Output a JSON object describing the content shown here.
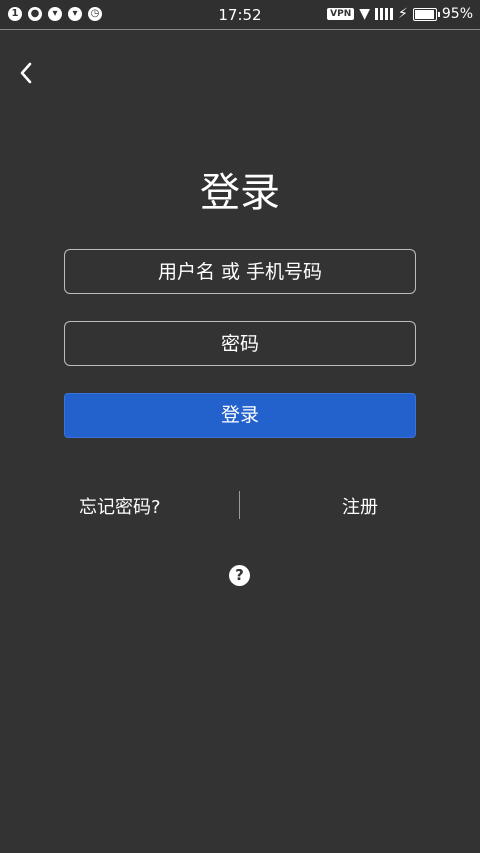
{
  "status_bar": {
    "time": "17:52",
    "vpn": "VPN",
    "battery": "95%",
    "battery_level": 0.95,
    "left_icons": [
      "notification-1-icon",
      "wechat-icon",
      "app-cat-icon",
      "app-cat-icon",
      "alarm-icon"
    ]
  },
  "header": {
    "back_icon": "back-arrow-icon"
  },
  "login": {
    "title": "登录",
    "username_placeholder": "用户名 或 手机号码",
    "password_placeholder": "密码",
    "submit_label": "登录"
  },
  "links": {
    "forgot_password": "忘记密码?",
    "register": "注册"
  },
  "help_icon": "?",
  "colors": {
    "background": "#333333",
    "primary": "#2361cc",
    "text": "#ffffff",
    "border": "#bdbdbd"
  }
}
